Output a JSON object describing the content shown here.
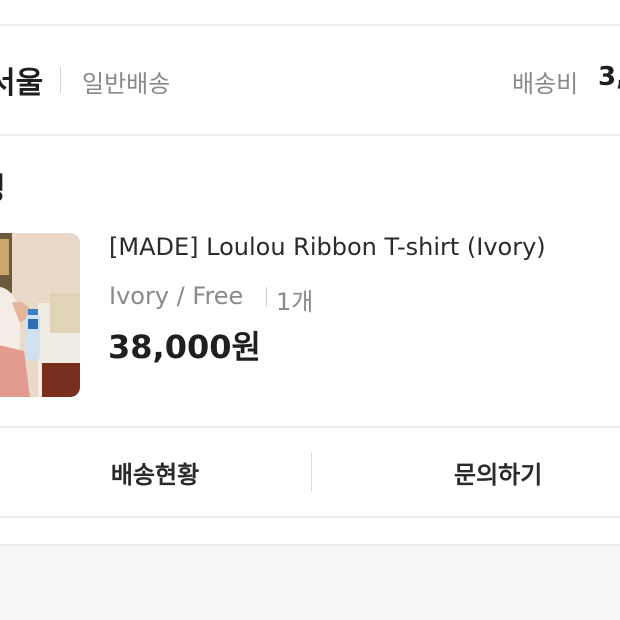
{
  "order": {
    "seller_name": "서울",
    "shipping_type": "일반배송",
    "shipping_fee_label": "배송비",
    "shipping_fee_value": "3,",
    "status_label": "정"
  },
  "product": {
    "name": "[MADE] Loulou Ribbon T-shirt (Ivory)",
    "option": "Ivory / Free",
    "quantity": "1개",
    "price": "38,000원"
  },
  "actions": {
    "track_label": "배송현황",
    "inquiry_label": "문의하기"
  },
  "colors": {
    "background": "#f6f6f7",
    "card": "#ffffff",
    "divider": "#ececee",
    "text_primary": "#1f1f1f",
    "text_secondary": "#8a8a8e"
  }
}
